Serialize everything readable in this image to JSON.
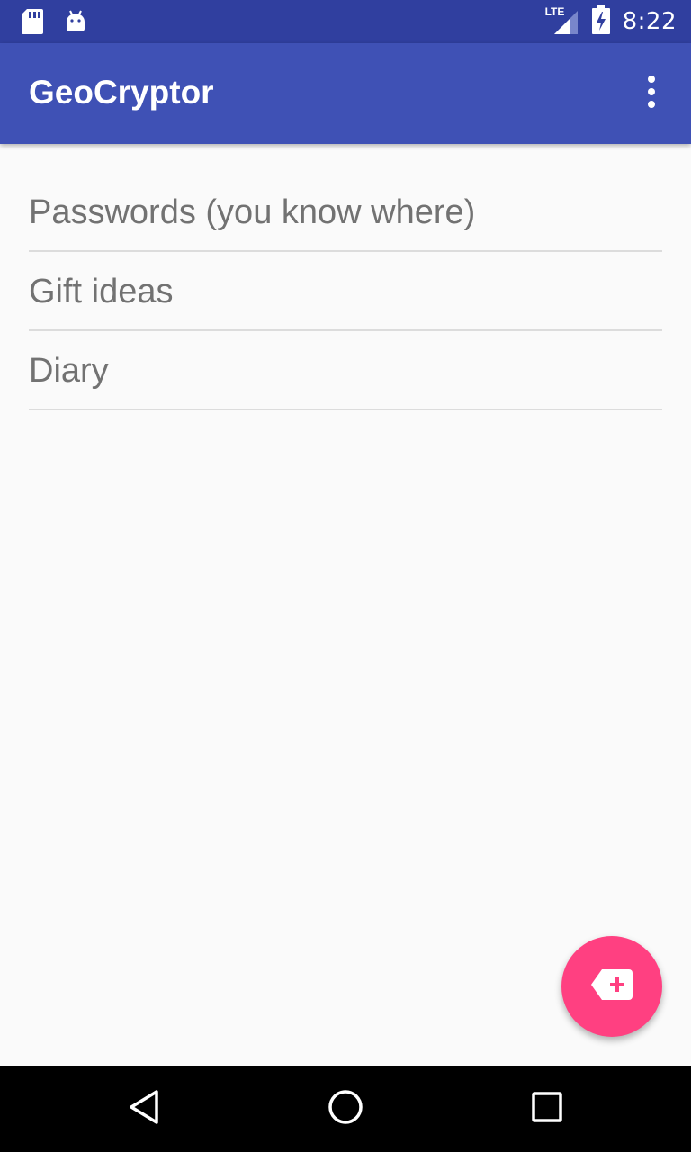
{
  "status_bar": {
    "time": "8:22",
    "network": "LTE",
    "left_icons": [
      "sd-card-icon",
      "android-icon"
    ],
    "right_icons": [
      "lte-signal-icon",
      "battery-charging-icon"
    ]
  },
  "app_bar": {
    "title": "GeoCryptor",
    "overflow_icon": "more-vert-icon",
    "background": "#3f51b5"
  },
  "list": {
    "items": [
      {
        "label": "Passwords (you know where)"
      },
      {
        "label": "Gift ideas"
      },
      {
        "label": "Diary"
      }
    ]
  },
  "fab": {
    "icon": "new-label-icon",
    "color": "#ff4081"
  },
  "nav_bar": {
    "buttons": [
      "back-icon",
      "home-icon",
      "recents-icon"
    ]
  },
  "colors": {
    "status_bar": "#303f9f",
    "primary": "#3f51b5",
    "accent": "#ff4081",
    "text_secondary": "#727272",
    "divider": "#dcdcdc"
  }
}
